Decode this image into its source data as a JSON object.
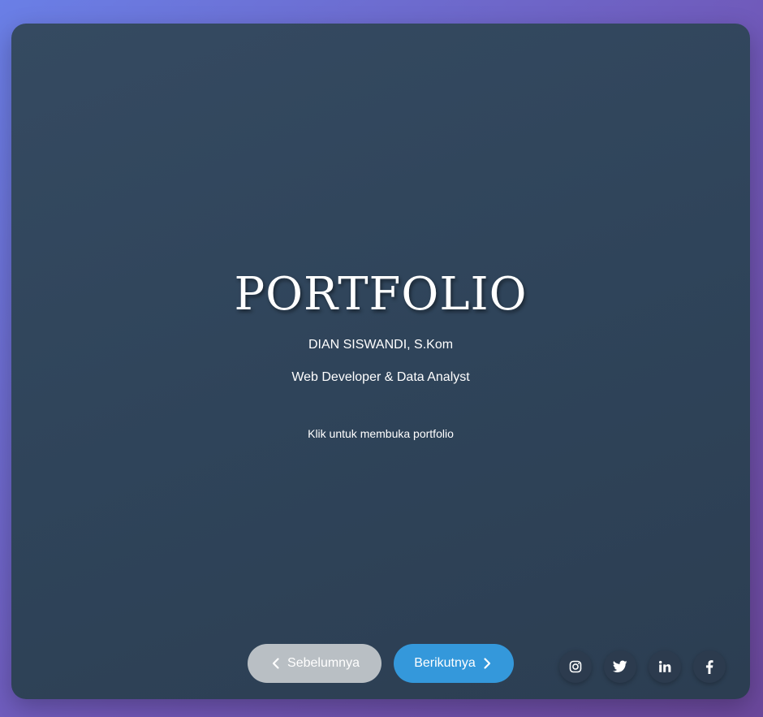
{
  "hero": {
    "title": "PORTFOLIO",
    "name": "DIAN SISWANDI, S.Kom",
    "role": "Web Developer & Data Analyst",
    "hint": "Klik untuk membuka portfolio"
  },
  "navigation": {
    "prev_label": "Sebelumnya",
    "next_label": "Berikutnya",
    "prev_icon": "chevron-left-icon",
    "next_icon": "chevron-right-icon"
  },
  "social": [
    {
      "icon": "instagram-icon"
    },
    {
      "icon": "twitter-icon"
    },
    {
      "icon": "linkedin-icon"
    },
    {
      "icon": "facebook-icon"
    }
  ],
  "colors": {
    "background_start": "#6a7fe6",
    "background_end": "#6b489c",
    "card": "#2f445a",
    "prev_button": "#b9bfc4",
    "next_button": "#3498db",
    "social_button": "#2c3b4e",
    "text": "#ffffff"
  }
}
